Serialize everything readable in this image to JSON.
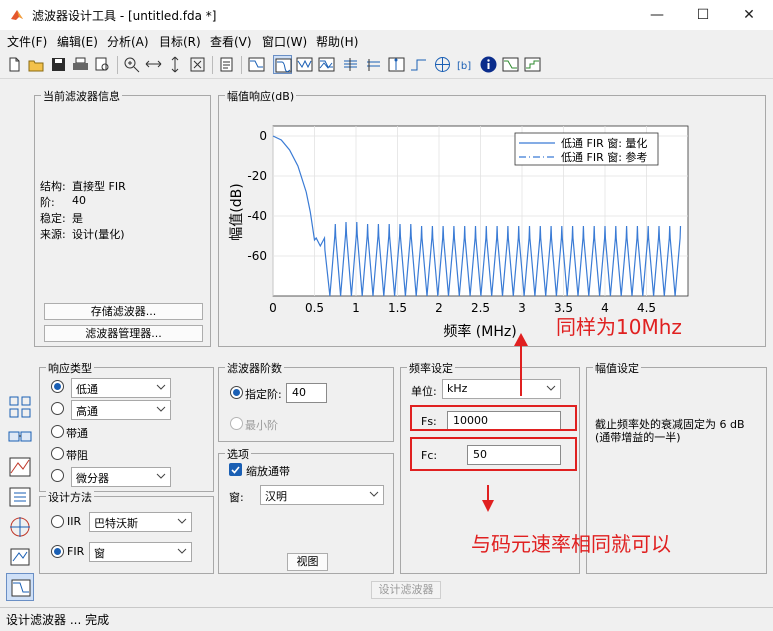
{
  "window": {
    "title": "滤波器设计工具 -  [untitled.fda *]",
    "minimize_glyph": "—",
    "maximize_glyph": "☐",
    "close_glyph": "✕"
  },
  "menu": [
    "文件(F)",
    "编辑(E)",
    "分析(A)",
    "目标(R)",
    "查看(V)",
    "窗口(W)",
    "帮助(H)"
  ],
  "toolbar_icons": [
    "new-icon",
    "open-icon",
    "save-icon",
    "print-icon",
    "print-preview-icon",
    "zoom-in-icon",
    "zoom-x-icon",
    "zoom-y-icon",
    "full-view-icon",
    "legend-icon",
    "filter-spec-icon",
    "magnitude-response-icon",
    "phase-response-icon",
    "mag-phase-icon",
    "group-delay-icon",
    "phase-delay-icon",
    "impulse-response-icon",
    "step-response-icon",
    "pole-zero-icon",
    "coefficients-icon",
    "info-icon",
    "cost-icon",
    "quantization-icon"
  ],
  "filter_info": {
    "title": "当前滤波器信息",
    "rows": [
      {
        "key": "结构:",
        "value": "直接型 FIR"
      },
      {
        "key": "阶:",
        "value": "40"
      },
      {
        "key": "稳定:",
        "value": "是"
      },
      {
        "key": "来源:",
        "value": "设计(量化)"
      }
    ],
    "store_button": "存储滤波器...",
    "manager_button": "滤波器管理器..."
  },
  "plot": {
    "panel_title": "幅值响应(dB)"
  },
  "chart_data": {
    "type": "line",
    "xlabel": "频率 (MHz)",
    "ylabel": "幅值(dB)",
    "xlim": [
      0,
      5
    ],
    "ylim": [
      -80,
      5
    ],
    "xticks": [
      "0",
      "0.5",
      "1",
      "1.5",
      "2",
      "2.5",
      "3",
      "3.5",
      "4",
      "4.5"
    ],
    "yticks": [
      "0",
      "-20",
      "-40",
      "-60"
    ],
    "grid": true,
    "legend_position": "top-right",
    "series": [
      {
        "name": "低通 FIR 窗: 量化",
        "style": "solid",
        "color": "#3a7bd5",
        "x": [
          0,
          0.1,
          0.2,
          0.3,
          0.4,
          0.45,
          0.5,
          0.52,
          0.57,
          0.62,
          0.75,
          0.88,
          1.01,
          1.14,
          1.27,
          1.4,
          1.53,
          1.66,
          1.79,
          1.92,
          2.05,
          2.18,
          2.31,
          2.44,
          2.57,
          2.7,
          2.83,
          2.96,
          3.09,
          3.22,
          3.35,
          3.48,
          3.61,
          3.74,
          3.87,
          4.0,
          4.13,
          4.26,
          4.39,
          4.52,
          4.65,
          4.78,
          4.91
        ],
        "y": [
          0,
          -2,
          -7,
          -15,
          -28,
          -38,
          -52,
          -51,
          -55,
          -51,
          -44,
          -43,
          -43,
          -44,
          -44,
          -44,
          -44,
          -44,
          -45,
          -45,
          -45,
          -45,
          -45,
          -45,
          -45,
          -45,
          -45,
          -45,
          -45,
          -45,
          -45,
          -45,
          -45,
          -45,
          -45,
          -45,
          -45,
          -45,
          -45,
          -45,
          -45,
          -45,
          -45
        ]
      },
      {
        "name": "低通 FIR 窗: 参考",
        "style": "dashdot",
        "color": "#3a7bd5",
        "x": [],
        "y": []
      }
    ]
  },
  "response_type": {
    "title": "响应类型",
    "options": [
      {
        "label": "低通",
        "selected": true,
        "kind": "select"
      },
      {
        "label": "高通",
        "selected": false,
        "kind": "select"
      },
      {
        "label": "带通",
        "selected": false,
        "kind": "radio"
      },
      {
        "label": "带阻",
        "selected": false,
        "kind": "radio"
      },
      {
        "label": "微分器",
        "selected": false,
        "kind": "select"
      }
    ]
  },
  "design_method": {
    "title": "设计方法",
    "iir_label": "IIR",
    "iir_value": "巴特沃斯",
    "fir_label": "FIR",
    "fir_value": "窗"
  },
  "filter_order": {
    "title": "滤波器阶数",
    "specify_label": "指定阶:",
    "specify_value": "40",
    "minimum_label": "最小阶"
  },
  "options": {
    "title": "选项",
    "scale_passband_label": "缩放通带",
    "window_label": "窗:",
    "window_value": "汉明",
    "view_button": "视图"
  },
  "frequency_spec": {
    "title": "频率设定",
    "unit_label": "单位:",
    "unit_value": "kHz",
    "fs_label": "Fs:",
    "fs_value": "10000",
    "fc_label": "Fc:",
    "fc_value": "50"
  },
  "magnitude_spec": {
    "title": "幅值设定",
    "note_line1": "截止频率处的衰减固定为 6 dB",
    "note_line2": "(通带增益的一半)"
  },
  "design_button": "设计滤波器",
  "status": "设计滤波器 ... 完成",
  "annotations": {
    "note_top": "同样为10Mhz",
    "note_bottom": "与码元速率相同就可以",
    "color": "#e02020"
  }
}
